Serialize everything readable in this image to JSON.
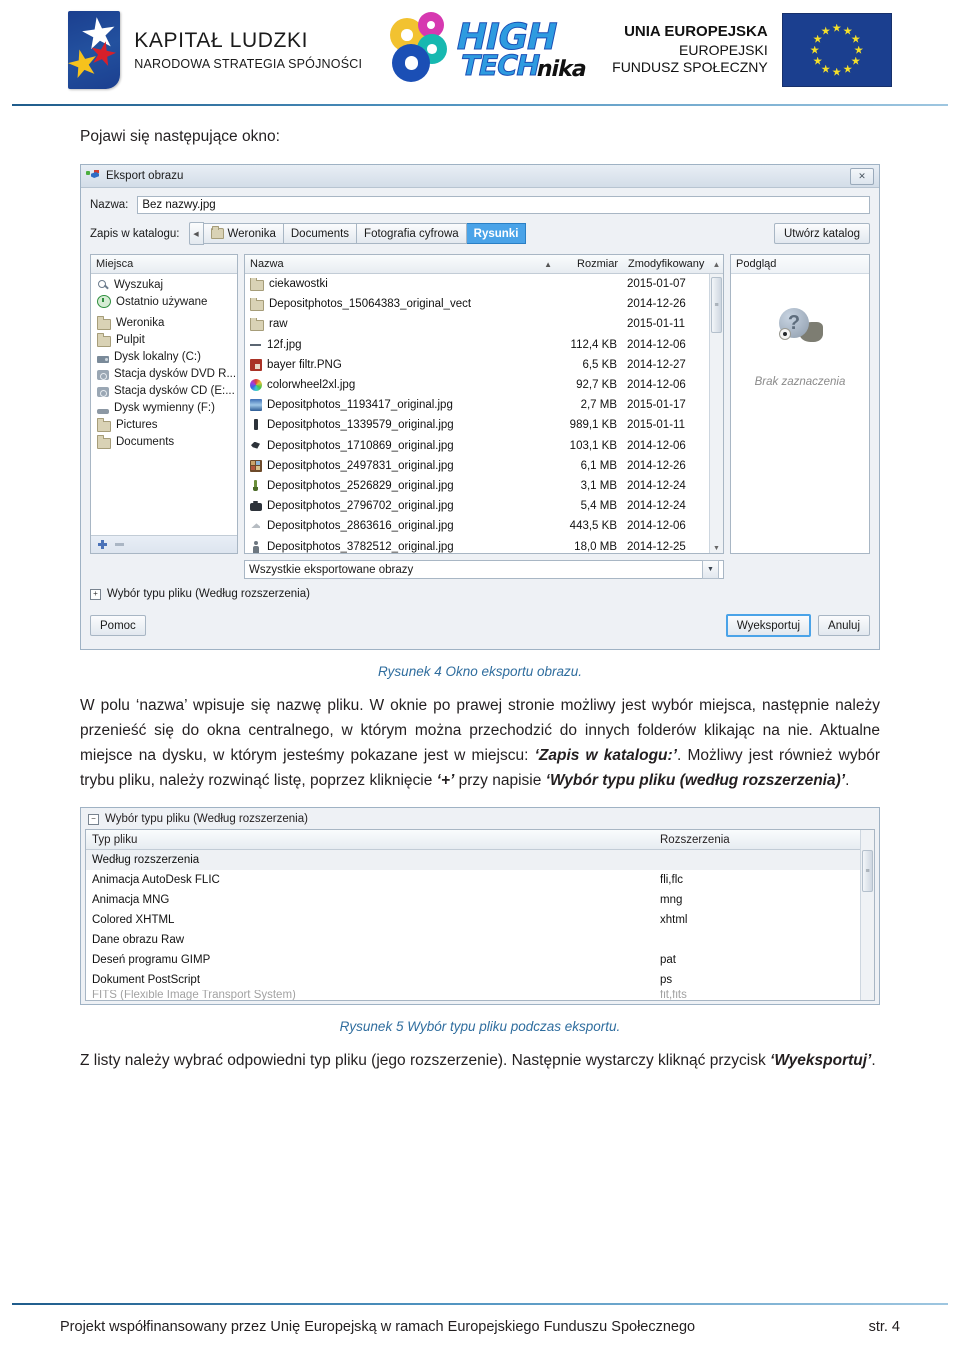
{
  "header": {
    "logo_kl": {
      "title": "KAPITAŁ LUDZKI",
      "subtitle": "NARODOWA STRATEGIA SPÓJNOŚCI"
    },
    "logo_hightech": {
      "word1": "HIGH",
      "word2": "TECH",
      "word3": "nika"
    },
    "logo_eu": {
      "line1": "UNIA EUROPEJSKA",
      "line2": "EUROPEJSKI",
      "line3": "FUNDUSZ SPOŁECZNY"
    }
  },
  "body": {
    "intro": "Pojawi się następujące okno:",
    "caption_fig4": "Rysunek 4 Okno eksportu obrazu.",
    "paragraph1_part1": "W polu ‘nazwa’ wpisuje się nazwę pliku. W oknie po prawej stronie możliwy jest wybór miejsca, następnie należy przenieść się do okna centralnego, w którym można przechodzić do innych folderów klikając na nie. Aktualne miejsce na dysku, w którym jesteśmy pokazane jest w miejscu: ",
    "paragraph1_bold1": "‘Zapis w katalogu:’",
    "paragraph1_part2": ". Możliwy jest również wybór trybu pliku, należy rozwinąć listę, poprzez kliknięcie ",
    "paragraph1_bold2": "‘+’",
    "paragraph1_part3": " przy napisie ",
    "paragraph1_bold3": "‘Wybór typu pliku (według rozszerzenia)’",
    "paragraph1_part4": ".",
    "caption_fig5": "Rysunek 5 Wybór typu pliku podczas eksportu.",
    "paragraph2_part1": "Z listy należy wybrać odpowiedni typ pliku (jego rozszerzenie). Następnie wystarczy kliknąć przycisk ",
    "paragraph2_bold1": "‘Wyeksportuj’",
    "paragraph2_part2": "."
  },
  "dialog": {
    "title": "Eksport obrazu",
    "close_label": "✕",
    "name_label": "Nazwa:",
    "name_value": "Bez nazwy.jpg",
    "path_label": "Zapis w katalogu:",
    "crumb_back": "◀",
    "crumbs": [
      {
        "label": "Weronika",
        "icon": "folder-icon",
        "active": false
      },
      {
        "label": "Documents",
        "icon": "",
        "active": false
      },
      {
        "label": "Fotografia cyfrowa",
        "icon": "",
        "active": false
      },
      {
        "label": "Rysunki",
        "icon": "",
        "active": true
      }
    ],
    "create_folder_button": "Utwórz katalog",
    "places_header": "Miejsca",
    "places": [
      {
        "label": "Wyszukaj",
        "icon": "search-icon",
        "type": "search"
      },
      {
        "label": "Ostatnio używane",
        "icon": "recent-icon",
        "type": "recent"
      },
      {
        "label": "Weronika",
        "icon": "folder-icon",
        "type": "folder"
      },
      {
        "label": "Pulpit",
        "icon": "folder-icon",
        "type": "folder"
      },
      {
        "label": "Dysk lokalny (C:)",
        "icon": "hard-drive-icon",
        "type": "hdd"
      },
      {
        "label": "Stacja dysków DVD R...",
        "icon": "optical-drive-icon",
        "type": "dvd"
      },
      {
        "label": "Stacja dysków CD (E:...",
        "icon": "optical-drive-icon",
        "type": "dvd"
      },
      {
        "label": "Dysk wymienny (F:)",
        "icon": "removable-drive-icon",
        "type": "rem"
      },
      {
        "label": "Pictures",
        "icon": "folder-icon",
        "type": "folder"
      },
      {
        "label": "Documents",
        "icon": "folder-icon",
        "type": "folder"
      }
    ],
    "bookmark_add_icon": "plus-icon",
    "bookmark_remove_icon": "minus-icon",
    "files_columns": {
      "name": "Nazwa",
      "size": "Rozmiar",
      "modified": "Zmodyfikowany",
      "sort_indicator": "▲"
    },
    "files": [
      {
        "name": "ciekawostki",
        "size": "",
        "date": "2015-01-07",
        "icon": "folder-icon"
      },
      {
        "name": "Depositphotos_15064383_original_vect",
        "size": "",
        "date": "2014-12-26",
        "icon": "folder-icon"
      },
      {
        "name": "raw",
        "size": "",
        "date": "2015-01-11",
        "icon": "folder-icon"
      },
      {
        "name": "12f.jpg",
        "size": "112,4 KB",
        "date": "2014-12-06",
        "icon": "dots-thumbnail-icon"
      },
      {
        "name": "bayer filtr.PNG",
        "size": "6,5 KB",
        "date": "2014-12-27",
        "icon": "red-thumbnail-icon"
      },
      {
        "name": "colorwheel2xl.jpg",
        "size": "92,7 KB",
        "date": "2014-12-06",
        "icon": "colorwheel-thumbnail-icon"
      },
      {
        "name": "Depositphotos_1193417_original.jpg",
        "size": "2,7 MB",
        "date": "2015-01-17",
        "icon": "blue-thumbnail-icon"
      },
      {
        "name": "Depositphotos_1339579_original.jpg",
        "size": "989,1 KB",
        "date": "2015-01-11",
        "icon": "dark-thumbnail-icon"
      },
      {
        "name": "Depositphotos_1710869_original.jpg",
        "size": "103,1 KB",
        "date": "2014-12-06",
        "icon": "bird-thumbnail-icon"
      },
      {
        "name": "Depositphotos_2497831_original.jpg",
        "size": "6,1 MB",
        "date": "2014-12-26",
        "icon": "mosaic-thumbnail-icon"
      },
      {
        "name": "Depositphotos_2526829_original.jpg",
        "size": "3,1 MB",
        "date": "2014-12-24",
        "icon": "pin-thumbnail-icon"
      },
      {
        "name": "Depositphotos_2796702_original.jpg",
        "size": "5,4 MB",
        "date": "2014-12-24",
        "icon": "camera-thumbnail-icon"
      },
      {
        "name": "Depositphotos_2863616_original.jpg",
        "size": "443,5 KB",
        "date": "2014-12-06",
        "icon": "grey-thumbnail-icon"
      },
      {
        "name": "Depositphotos_3782512_original.jpg",
        "size": "18,0 MB",
        "date": "2014-12-25",
        "icon": "person-thumbnail-icon"
      }
    ],
    "preview_header": "Podgląd",
    "preview_empty_text": "Brak zaznaczenia",
    "filter_value": "Wszystkie eksportowane obrazy",
    "expander_label": "Wybór typu pliku (Według rozszerzenia)",
    "expander_sign": "+",
    "help_button": "Pomoc",
    "export_button": "Wyeksportuj",
    "cancel_button": "Anuluj"
  },
  "filetype_panel": {
    "expander_label": "Wybór typu pliku (Według rozszerzenia)",
    "expander_sign": "−",
    "columns": {
      "type": "Typ pliku",
      "extensions": "Rozszerzenia"
    },
    "rows": [
      {
        "type": "Według rozszerzenia",
        "ext": "",
        "highlight": true
      },
      {
        "type": "Animacja AutoDesk FLIC",
        "ext": "fli,flc",
        "highlight": false
      },
      {
        "type": "Animacja MNG",
        "ext": "mng",
        "highlight": false
      },
      {
        "type": "Colored XHTML",
        "ext": "xhtml",
        "highlight": false
      },
      {
        "type": "Dane obrazu Raw",
        "ext": "",
        "highlight": false
      },
      {
        "type": "Deseń programu GIMP",
        "ext": "pat",
        "highlight": false
      },
      {
        "type": "Dokument PostScript",
        "ext": "ps",
        "highlight": false
      },
      {
        "type": "FITS (Flexible Image Transport System)",
        "ext": "fit,fits",
        "highlight": false
      }
    ]
  },
  "footer": {
    "text": "Projekt współfinansowany przez Unię Europejską w ramach Europejskiego Funduszu Społecznego",
    "page": "str. 4"
  }
}
